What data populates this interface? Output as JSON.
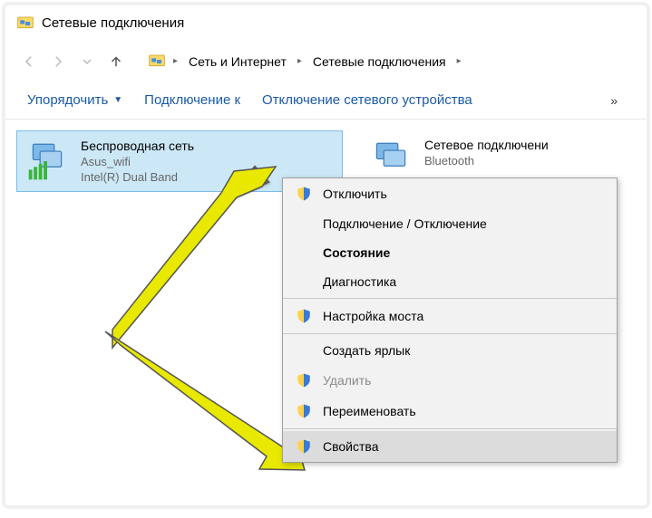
{
  "window_title": "Сетевые подключения",
  "breadcrumb": {
    "items": [
      "Сеть и Интернет",
      "Сетевые подключения"
    ]
  },
  "toolbar": {
    "organize": "Упорядочить",
    "connect_to": "Подключение к",
    "disable_device": "Отключение сетевого устройства",
    "overflow": "»"
  },
  "adapters": {
    "wifi": {
      "name": "Беспроводная сеть",
      "ssid": "Asus_wifi",
      "driver": "Intel(R) Dual Band"
    },
    "bt": {
      "name": "Сетевое подключени",
      "sub": "Bluetooth"
    }
  },
  "context_menu": {
    "disable": "Отключить",
    "connect_disconnect": "Подключение / Отключение",
    "status": "Состояние",
    "diagnose": "Диагностика",
    "bridge": "Настройка моста",
    "shortcut": "Создать ярлык",
    "delete": "Удалить",
    "rename": "Переименовать",
    "properties": "Свойства"
  }
}
